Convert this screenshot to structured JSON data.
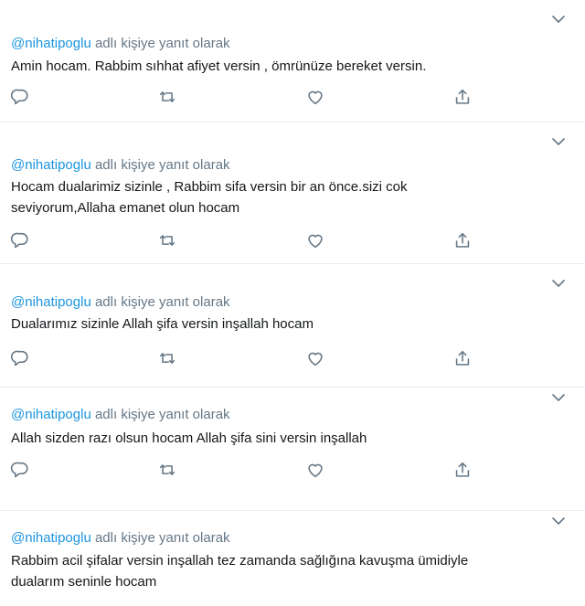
{
  "context": {
    "handle": "@nihatipoglu",
    "suffix": "adlı kişiye yanıt olarak"
  },
  "replies": [
    {
      "lines": [
        "Amin hocam. Rabbim sıhhat afiyet versin ,  ömrünüze bereket versin."
      ]
    },
    {
      "lines": [
        "Hocam dualarimiz sizinle , Rabbim sifa versin bir an önce.sizi cok",
        "seviyorum,Allaha emanet olun hocam"
      ]
    },
    {
      "lines": [
        "Dualarımız sizinle Allah şifa versin inşallah hocam"
      ]
    },
    {
      "lines": [
        "Allah sizden razı olsun hocam Allah şifa sini versin inşallah"
      ]
    },
    {
      "lines": [
        "Rabbim acil şifalar versin inşallah tez zamanda sağlığına kavuşma ümidiyle",
        "dualarım seninle  hocam"
      ]
    }
  ],
  "icons": {
    "caret": "chevron-down-icon",
    "reply": "reply-icon",
    "retweet": "retweet-icon",
    "like": "heart-icon",
    "share": "share-icon"
  },
  "colors": {
    "handle": "#1b95e0",
    "muted": "#657786",
    "text": "#14171a",
    "divider": "#e6ecf0"
  }
}
